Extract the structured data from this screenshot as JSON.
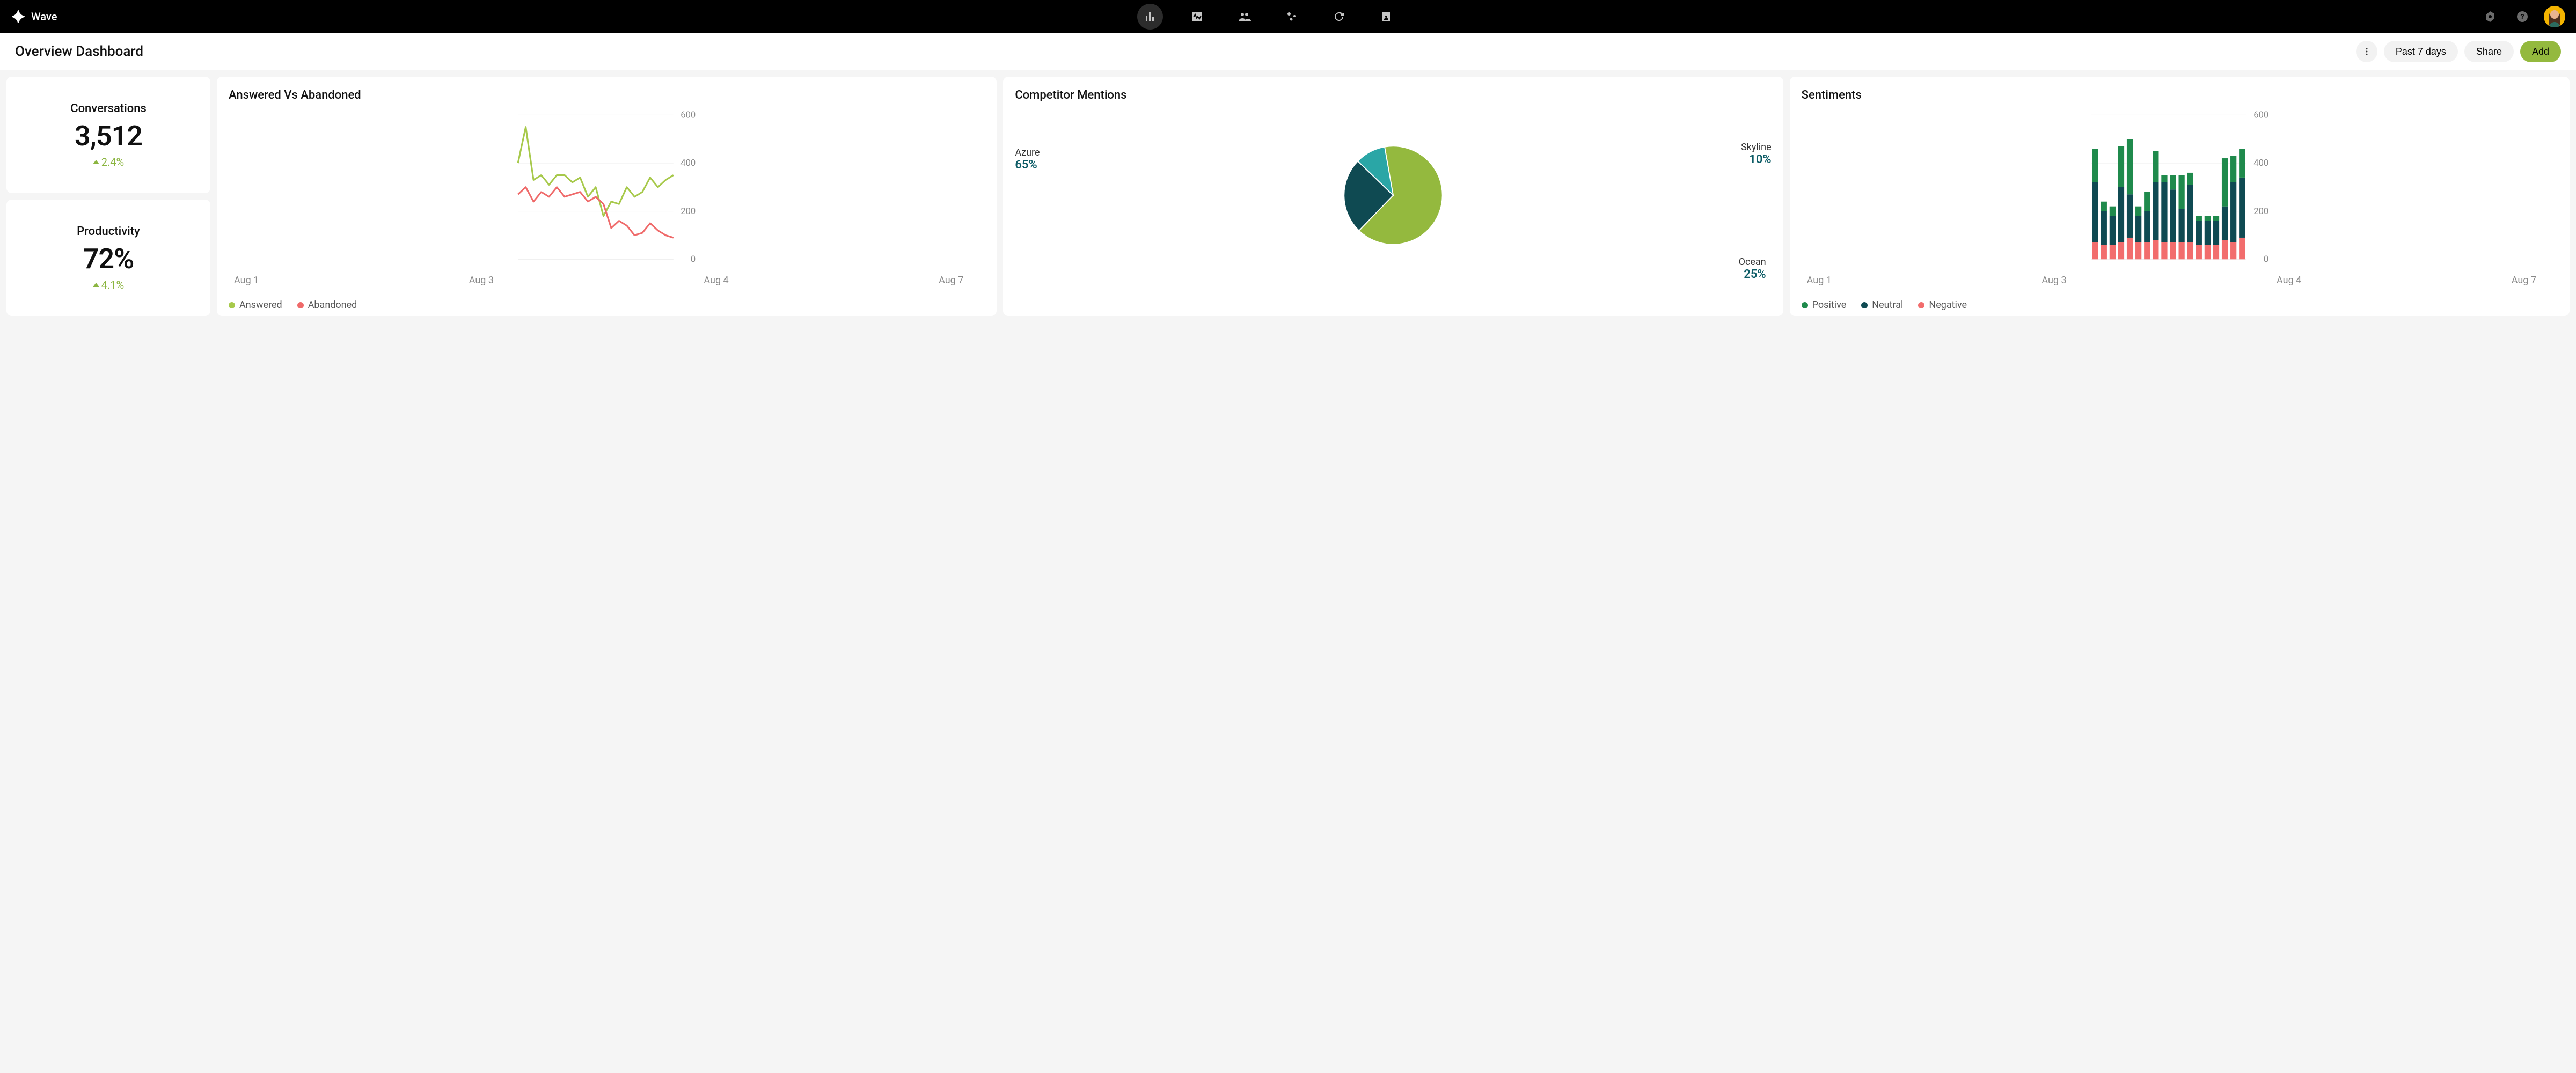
{
  "brand": "Wave",
  "page_title": "Overview Dashboard",
  "toolbar": {
    "date_range": "Past 7 days",
    "share": "Share",
    "add": "Add"
  },
  "colors": {
    "answered": "#a7c94b",
    "abandoned": "#ef6a6a",
    "pie_azure": "#94b93e",
    "pie_skyline": "#2aa6a6",
    "pie_ocean": "#0f4a52",
    "pos": "#1f8a4c",
    "neu": "#0f4a52",
    "neg": "#f26d6d",
    "primary": "#94b93e"
  },
  "kpis": {
    "conversations": {
      "label": "Conversations",
      "value": "3,512",
      "delta": "2.4%"
    },
    "productivity": {
      "label": "Productivity",
      "value": "72%",
      "delta": "4.1%"
    }
  },
  "chart_data": [
    {
      "id": "answered_abandoned",
      "type": "line",
      "title": "Answered Vs Abandoned",
      "xlabel": "",
      "ylabel": "",
      "ylim": [
        0,
        600
      ],
      "y_ticks": [
        0,
        200,
        400,
        600
      ],
      "x_tick_labels": [
        "Aug 1",
        "Aug 3",
        "Aug 4",
        "Aug 7"
      ],
      "x": [
        1,
        2,
        3,
        4,
        5,
        6,
        7,
        8,
        9,
        10,
        11,
        12,
        13,
        14,
        15,
        16,
        17,
        18,
        19,
        20,
        21
      ],
      "series": [
        {
          "name": "Answered",
          "color": "#a7c94b",
          "values": [
            400,
            550,
            330,
            350,
            310,
            350,
            350,
            320,
            340,
            260,
            300,
            180,
            240,
            230,
            300,
            260,
            280,
            340,
            300,
            330,
            350
          ]
        },
        {
          "name": "Abandoned",
          "color": "#ef6a6a",
          "values": [
            270,
            300,
            240,
            280,
            260,
            300,
            260,
            270,
            280,
            240,
            260,
            230,
            130,
            160,
            140,
            100,
            110,
            150,
            120,
            100,
            90
          ]
        }
      ]
    },
    {
      "id": "competitor_mentions",
      "type": "pie",
      "title": "Competitor Mentions",
      "slices": [
        {
          "name": "Azure",
          "pct": 65,
          "color": "#94b93e",
          "label_pct": "65%"
        },
        {
          "name": "Ocean",
          "pct": 25,
          "color": "#0f4a52",
          "label_pct": "25%"
        },
        {
          "name": "Skyline",
          "pct": 10,
          "color": "#2aa6a6",
          "label_pct": "10%"
        }
      ]
    },
    {
      "id": "sentiments",
      "type": "bar",
      "stacked": true,
      "title": "Sentiments",
      "ylim": [
        0,
        600
      ],
      "y_ticks": [
        0,
        200,
        400,
        600
      ],
      "x_tick_labels": [
        "Aug 1",
        "Aug 3",
        "Aug 4",
        "Aug 7"
      ],
      "categories": [
        1,
        2,
        3,
        4,
        5,
        6,
        7,
        8,
        9,
        10,
        11,
        12,
        13,
        14,
        15,
        16,
        17,
        18
      ],
      "series": [
        {
          "name": "Negative",
          "color": "#f26d6d",
          "values": [
            70,
            60,
            60,
            70,
            90,
            70,
            70,
            80,
            70,
            70,
            70,
            70,
            60,
            60,
            60,
            80,
            70,
            90
          ]
        },
        {
          "name": "Neutral",
          "color": "#0f4a52",
          "values": [
            250,
            140,
            120,
            230,
            180,
            110,
            130,
            240,
            250,
            220,
            140,
            240,
            100,
            100,
            100,
            140,
            250,
            250
          ]
        },
        {
          "name": "Positive",
          "color": "#1f8a4c",
          "values": [
            140,
            40,
            40,
            170,
            230,
            40,
            80,
            130,
            30,
            60,
            140,
            50,
            20,
            20,
            20,
            200,
            110,
            120
          ]
        }
      ],
      "legend": [
        "Positive",
        "Neutral",
        "Negative"
      ]
    }
  ]
}
